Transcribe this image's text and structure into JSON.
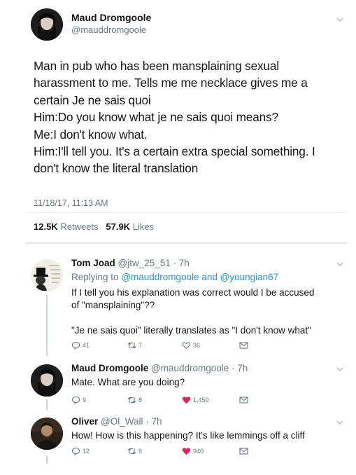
{
  "main": {
    "name": "Maud Dromgoole",
    "handle": "@mauddromgoole",
    "text_lines": [
      "Man in pub who has been mansplaining sexual",
      "harassment to me. Tells me me necklace gives me a",
      "certain Je ne sais quoi",
      "Him:Do you know what je ne sais quoi means?",
      "Me:I don't know what.",
      "Him:I'll tell you. It's a certain extra special something. I",
      "don't know the literal translation"
    ],
    "timestamp": "11/18/17, 11:13 AM",
    "retweets_count": "12.5K",
    "retweets_label": "Retweets",
    "likes_count": "57.9K",
    "likes_label": "Likes"
  },
  "replies": [
    {
      "name": "Tom Joad",
      "meta": "@jtw_25_51 · 7h",
      "replying_prefix": "Replying to",
      "replying_user1": "@mauddromgoole",
      "replying_and": "and",
      "replying_user2": "@youngian67",
      "text_lines": [
        "If I tell you his explanation was correct would I be accused",
        "of \"mansplaining\"??",
        "",
        "\"Je ne sais quoi\" literally translates as \"I don't know what\""
      ],
      "reply_count": "41",
      "retweet_count": "7",
      "like_count": "36",
      "liked": false,
      "avatar_icon": "tophat-avatar-icon"
    },
    {
      "name": "Maud Dromgoole",
      "meta": "@mauddromgoole · 7h",
      "text_lines": [
        "Mate. What are you doing?"
      ],
      "reply_count": "9",
      "retweet_count": "8",
      "like_count": "1,459",
      "liked": true
    },
    {
      "name": "Oliver",
      "meta": "@Ol_Wall · 7h",
      "text_lines": [
        "How! How is this happening? It's like lemmings off a cliff"
      ],
      "reply_count": "12",
      "retweet_count": "9",
      "like_count": "940",
      "liked": true
    }
  ],
  "colors": {
    "text": "#14171a",
    "muted": "#657786",
    "link": "#1b95e0",
    "like_red": "#e0245e",
    "divider": "#e6ecf0"
  }
}
